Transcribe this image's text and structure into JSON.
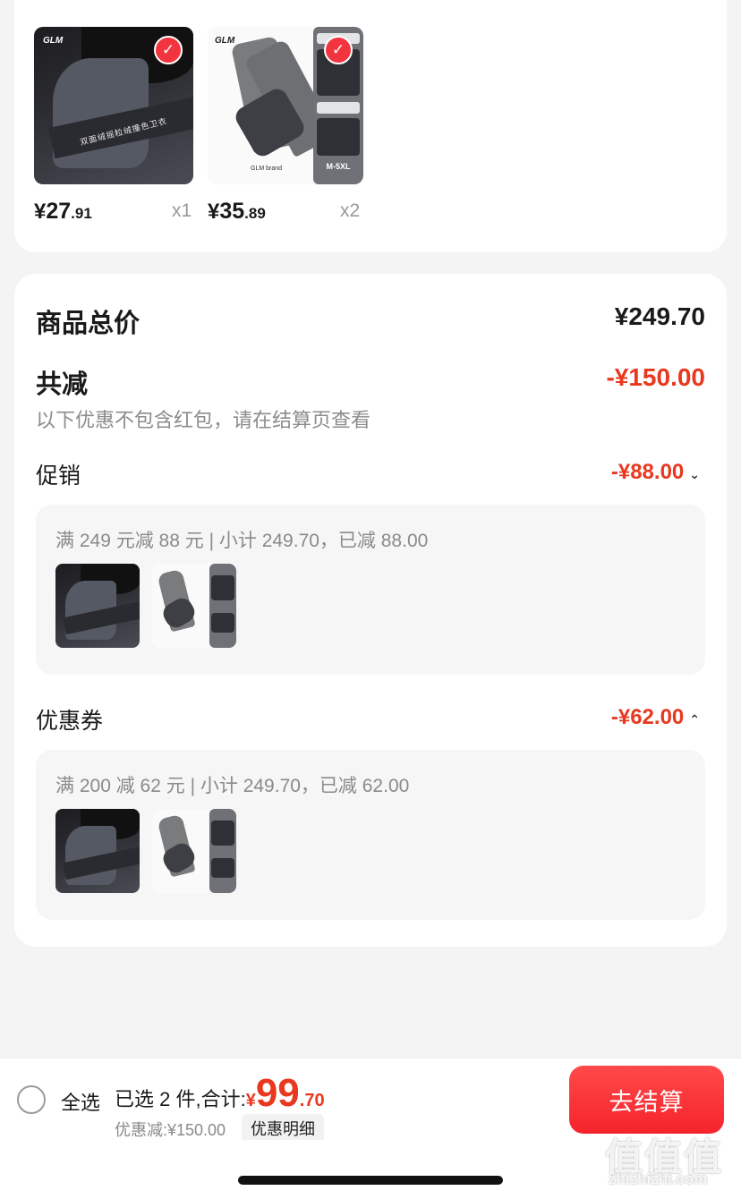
{
  "products": [
    {
      "name_text": "双面绒摇粒绒撞色卫衣",
      "logo": "GLM",
      "price_symbol": "¥",
      "price_int": "27",
      "price_dec": ".91",
      "qty": "x1",
      "selected": true
    },
    {
      "logo": "GLM",
      "brand": "GLM brand",
      "size": "M-5XL",
      "price_symbol": "¥",
      "price_int": "35",
      "price_dec": ".89",
      "qty": "x2",
      "selected": true
    }
  ],
  "summary": {
    "total_label": "商品总价",
    "total_value": "¥249.70",
    "reduce_label": "共减",
    "reduce_value": "-¥150.00",
    "reduce_note": "以下优惠不包含红包，请在结算页查看",
    "promo": {
      "label": "促销",
      "value": "-¥88.00",
      "chevron": "⌄",
      "detail": "满 249 元减 88 元 | 小计 249.70，已减 88.00"
    },
    "coupon": {
      "label": "优惠券",
      "value": "-¥62.00",
      "chevron": "⌃",
      "detail": "满 200 减 62 元 | 小计 249.70，已减 62.00"
    }
  },
  "bottom_bar": {
    "select_all": "全选",
    "selected_text": "已选 2 件,合计:",
    "total_symbol": "¥",
    "total_int": "99",
    "total_dec": ".70",
    "discount_text": "优惠减:¥150.00",
    "discount_detail": "优惠明细",
    "checkout": "去结算"
  },
  "watermark": {
    "top": "值值值",
    "bottom": "zhizhizhi.com"
  },
  "colors": {
    "accent_red": "#e8381f",
    "checkout_red": "#f5232c",
    "background": "#f4f4f4"
  }
}
